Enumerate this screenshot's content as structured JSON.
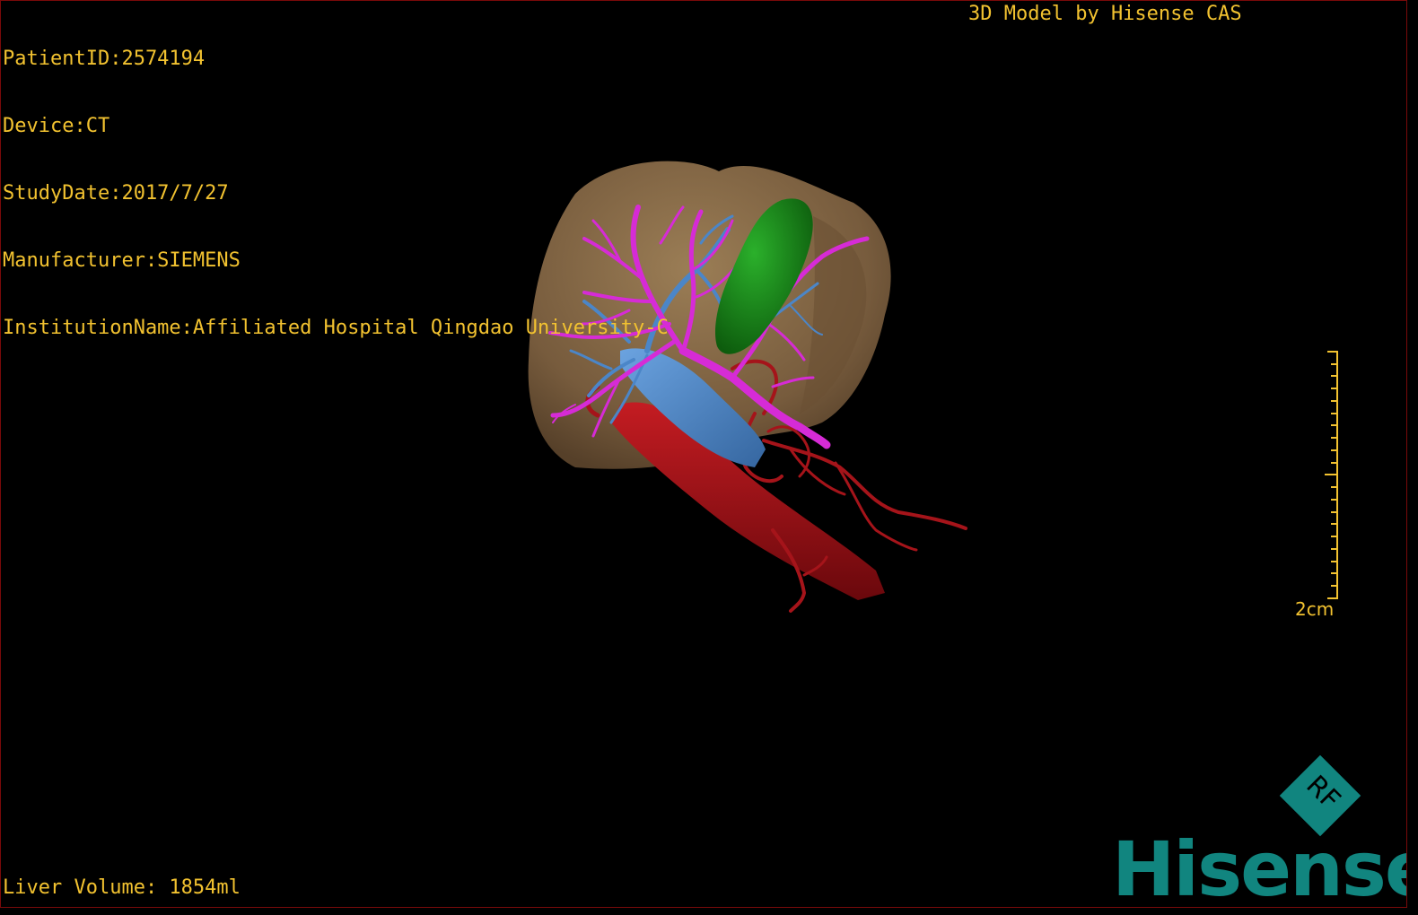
{
  "header": {
    "patient_id": "PatientID:2574194",
    "device": "Device:CT",
    "study_date": "StudyDate:2017/7/27",
    "manufacturer": "Manufacturer:SIEMENS",
    "institution": "InstitutionName:Affiliated Hospital Qingdao University-C"
  },
  "brand_text": "3D Model by Hisense CAS",
  "footer": {
    "liver_volume": "Liver Volume: 1854ml"
  },
  "scale": {
    "label": "2cm"
  },
  "logo": {
    "letters": "RF",
    "wordmark": "Hisense"
  },
  "colors": {
    "overlay_text": "#f2c230",
    "liver": "#8c6d46",
    "hepatic_vein": "#d62bd6",
    "portal_vein": "#4b86c8",
    "gallbladder": "#1a8a1a",
    "artery": "#a5141a",
    "brand": "#11857f"
  }
}
